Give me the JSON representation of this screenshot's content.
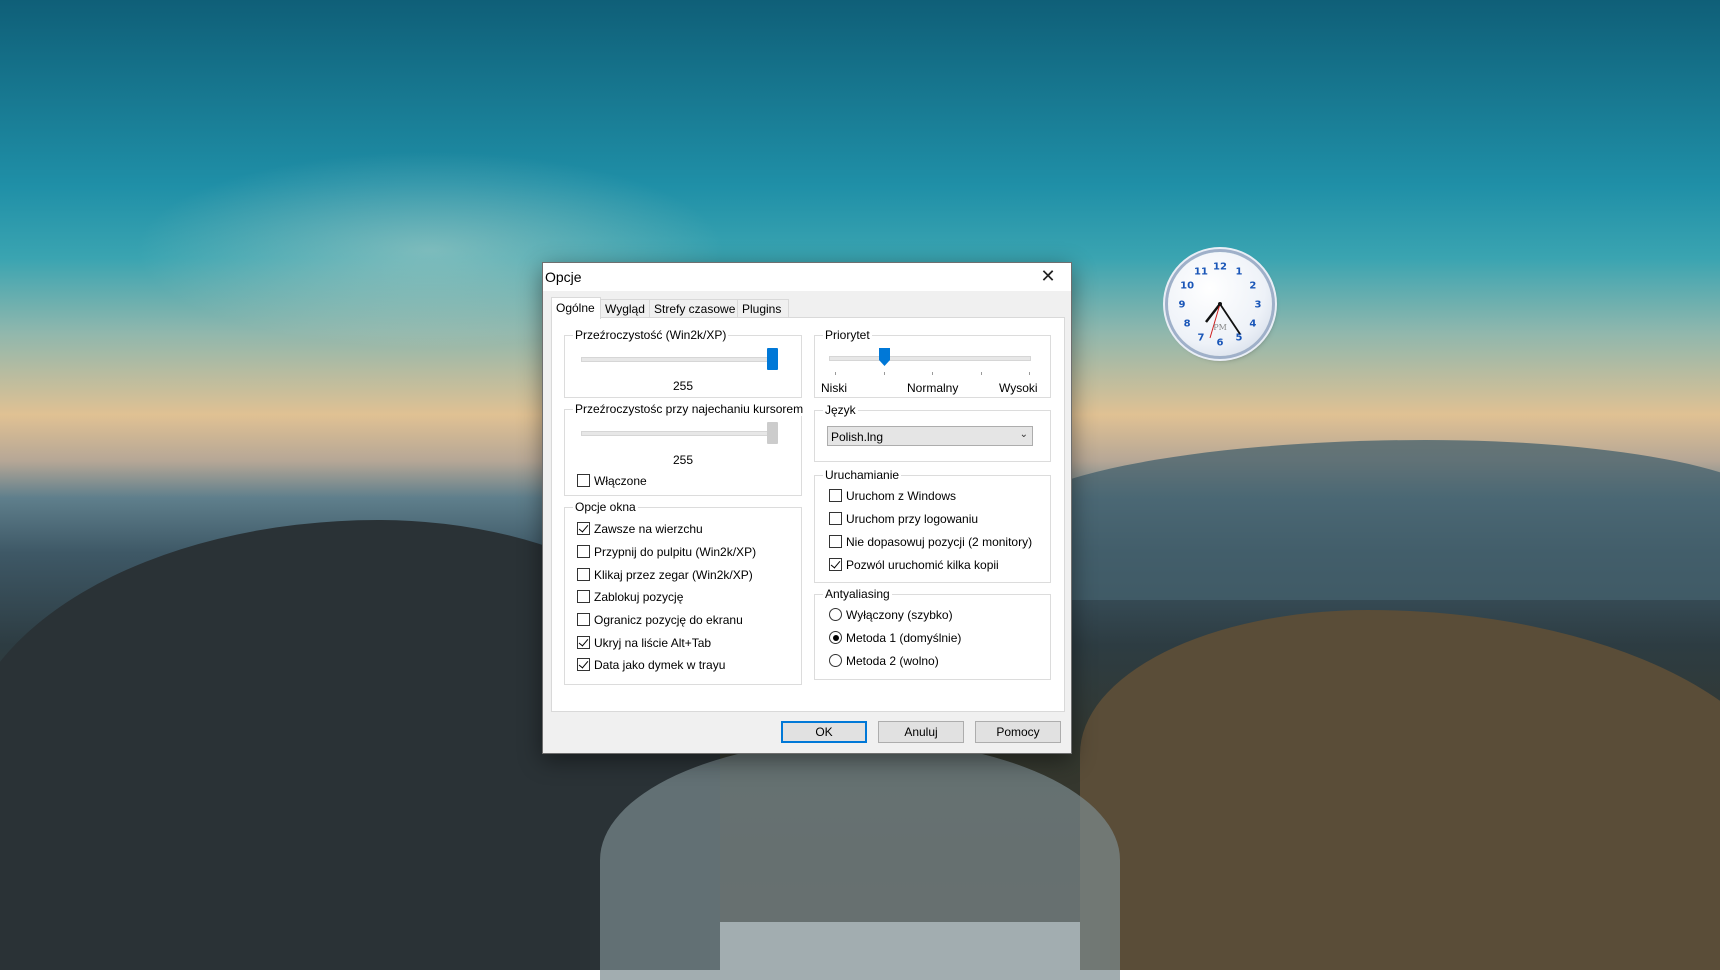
{
  "dialog": {
    "title": "Opcje",
    "close_glyph": "✕",
    "tabs": [
      "Ogólne",
      "Wygląd",
      "Strefy czasowe",
      "Plugins"
    ],
    "transparency": {
      "label": "Przeźroczystość (Win2k/XP)",
      "value": "255"
    },
    "hover_transparency": {
      "label": "Przeźroczystośc przy najechaniu kursorem",
      "value": "255",
      "enabled_label": "Włączone",
      "enabled": false
    },
    "window_options": {
      "label": "Opcje okna",
      "items": [
        {
          "label": "Zawsze na wierzchu",
          "checked": true
        },
        {
          "label": "Przypnij do pulpitu (Win2k/XP)",
          "checked": false
        },
        {
          "label": "Klikaj przez zegar (Win2k/XP)",
          "checked": false
        },
        {
          "label": "Zablokuj pozycję",
          "checked": false
        },
        {
          "label": "Ogranicz pozycję do ekranu",
          "checked": false
        },
        {
          "label": "Ukryj na liście Alt+Tab",
          "checked": true
        },
        {
          "label": "Data jako dymek w trayu",
          "checked": true
        }
      ]
    },
    "priority": {
      "label": "Priorytet",
      "low": "Niski",
      "normal": "Normalny",
      "high": "Wysoki"
    },
    "language": {
      "label": "Język",
      "selected": "Polish.lng"
    },
    "startup": {
      "label": "Uruchamianie",
      "items": [
        {
          "label": "Uruchom z Windows",
          "checked": false
        },
        {
          "label": "Uruchom przy logowaniu",
          "checked": false
        },
        {
          "label": "Nie dopasowuj pozycji (2 monitory)",
          "checked": false
        },
        {
          "label": "Pozwól uruchomić kilka kopii",
          "checked": true
        }
      ]
    },
    "antialiasing": {
      "label": "Antyaliasing",
      "items": [
        {
          "label": "Wyłączony (szybko)",
          "selected": false
        },
        {
          "label": "Metoda 1 (domyślnie)",
          "selected": true
        },
        {
          "label": "Metoda 2 (wolno)",
          "selected": false
        }
      ]
    },
    "buttons": {
      "ok": "OK",
      "cancel": "Anuluj",
      "help": "Pomocy"
    }
  },
  "clock": {
    "numbers": [
      "12",
      "1",
      "2",
      "3",
      "4",
      "5",
      "6",
      "7",
      "8",
      "9",
      "10",
      "11"
    ],
    "ampm": "PM"
  },
  "colors": {
    "accent": "#0078d7",
    "clock_numbers": "#1a56b8"
  }
}
